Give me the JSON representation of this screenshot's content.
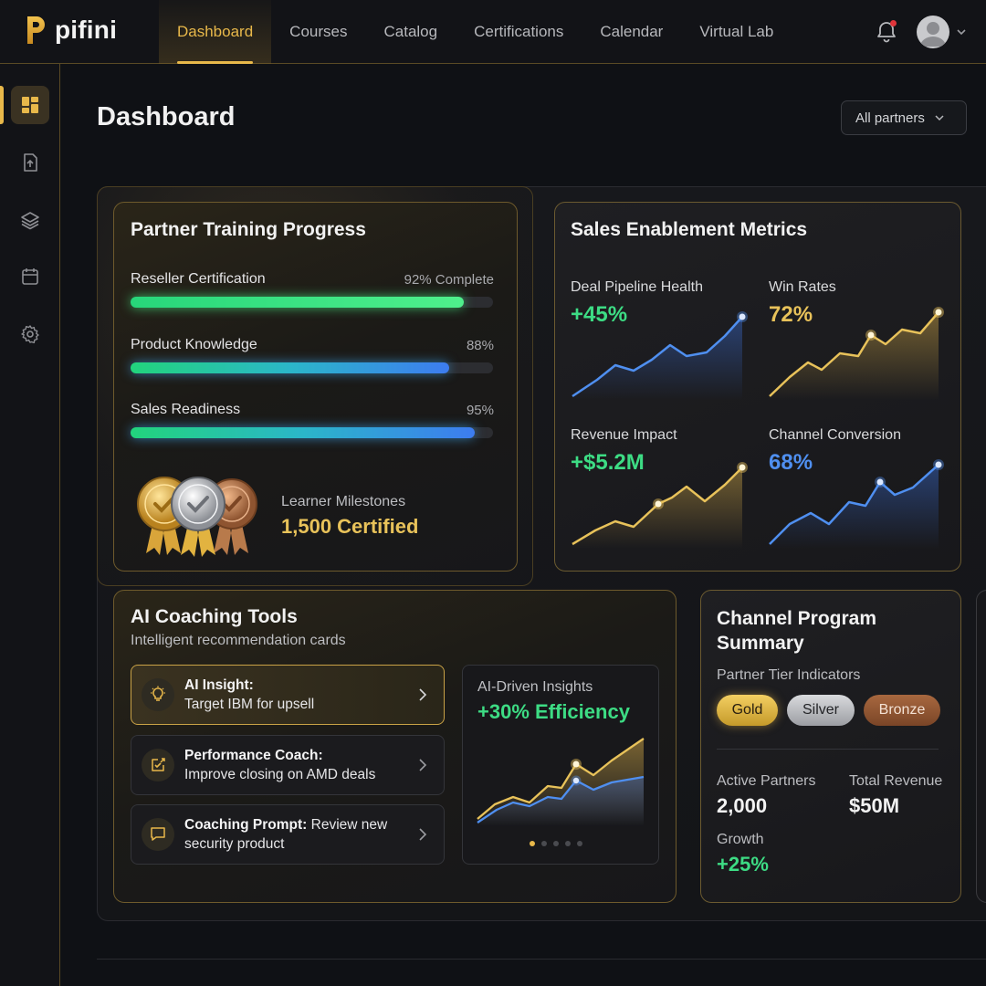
{
  "app": {
    "brand": "pifini"
  },
  "nav": {
    "items": [
      {
        "label": "Dashboard",
        "active": true
      },
      {
        "label": "Courses"
      },
      {
        "label": "Catalog"
      },
      {
        "label": "Certifications"
      },
      {
        "label": "Calendar"
      },
      {
        "label": "Virtual Lab"
      }
    ]
  },
  "header_icons": [
    "bell-icon",
    "avatar",
    "chevron-down-icon"
  ],
  "sidebar": {
    "items": [
      {
        "icon": "dashboard-grid-icon",
        "active": true
      },
      {
        "icon": "document-upload-icon"
      },
      {
        "icon": "layers-icon"
      },
      {
        "icon": "calendar-icon"
      },
      {
        "icon": "gear-icon"
      }
    ]
  },
  "page": {
    "title": "Dashboard",
    "filter": "All partners"
  },
  "training": {
    "title": "Partner Training Progress",
    "items": [
      {
        "label": "Reseller Certification",
        "value_text": "92% Complete",
        "percent": 92
      },
      {
        "label": "Product Knowledge",
        "value_text": "88%",
        "percent": 88
      },
      {
        "label": "Sales Readiness",
        "value_text": "95%",
        "percent": 95
      }
    ],
    "milestones_label": "Learner Milestones",
    "milestones_value": "1,500 Certified",
    "medals": [
      "gold",
      "silver",
      "bronze"
    ]
  },
  "metrics": {
    "title": "Sales Enablement Metrics",
    "items": [
      {
        "label": "Deal Pipeline Health",
        "value": "+45%",
        "color": "#3ddc84"
      },
      {
        "label": "Win Rates",
        "value": "72%",
        "color": "#e8c25a"
      },
      {
        "label": "Revenue Impact",
        "value": "+$5.2M",
        "color": "#3ddc84"
      },
      {
        "label": "Channel Conversion",
        "value": "68%",
        "color": "#4f8ff0"
      }
    ]
  },
  "coaching": {
    "title": "AI Coaching Tools",
    "subtitle": "Intelligent recommendation cards",
    "cards": [
      {
        "title": "AI Insight:",
        "text": "Target IBM for upsell",
        "icon": "lightbulb-icon"
      },
      {
        "title": "Performance Coach:",
        "text": "Improve closing on AMD deals",
        "icon": "check-badge-icon"
      },
      {
        "title": "Coaching Prompt:",
        "text": "Review new security product",
        "icon": "chat-icon"
      }
    ],
    "insights_label": "AI-Driven Insights",
    "insights_value": "+30% Efficiency"
  },
  "program": {
    "title_line1": "Channel Program",
    "title_line2": "Summary",
    "tier_label": "Partner Tier Indicators",
    "tiers": [
      "Gold",
      "Silver",
      "Bronze"
    ],
    "active_partners_label": "Active Partners",
    "active_partners_value": "2,000",
    "total_revenue_label": "Total Revenue",
    "total_revenue_value": "$50M",
    "growth_label": "Growth",
    "growth_value": "+25%"
  },
  "colors": {
    "accent_gold": "#e8b84a",
    "green": "#3ddc84",
    "blue": "#4f8ff0"
  }
}
